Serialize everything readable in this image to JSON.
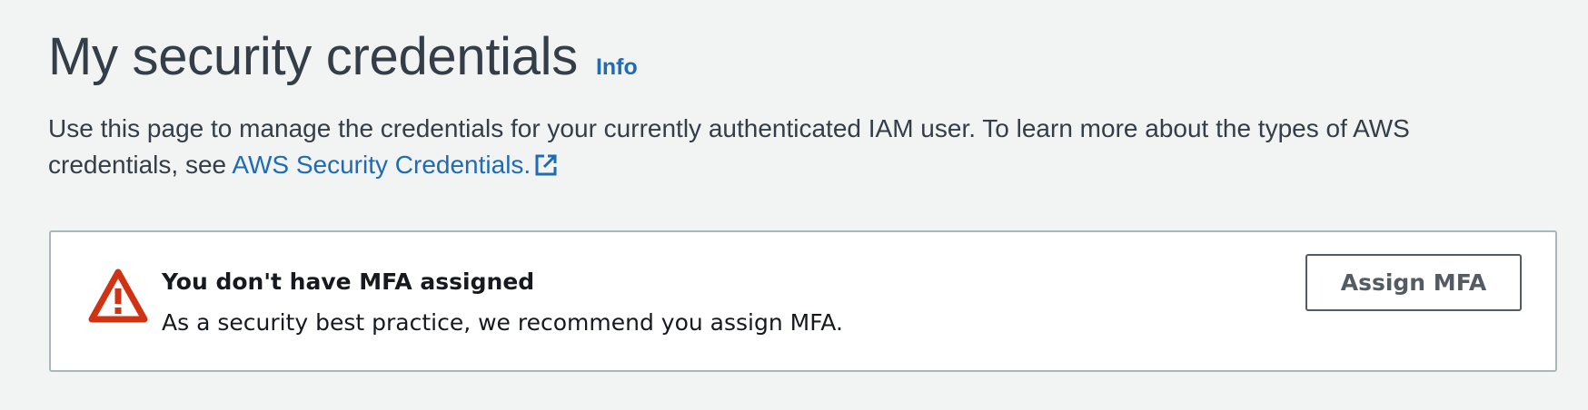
{
  "header": {
    "title": "My security credentials",
    "info_link": "Info"
  },
  "description": {
    "text": "Use this page to manage the credentials for your currently authenticated IAM user. To learn more about the types of AWS credentials, see ",
    "link_label": "AWS Security Credentials.",
    "link_icon": "external-link-icon"
  },
  "alert": {
    "icon": "warning-icon",
    "title": "You don't have MFA assigned",
    "message": "As a security best practice, we recommend you assign MFA.",
    "button_label": "Assign MFA"
  },
  "colors": {
    "background": "#f2f3f3",
    "link": "#1f6bb5",
    "warning": "#d13212",
    "text": "#333e48"
  }
}
